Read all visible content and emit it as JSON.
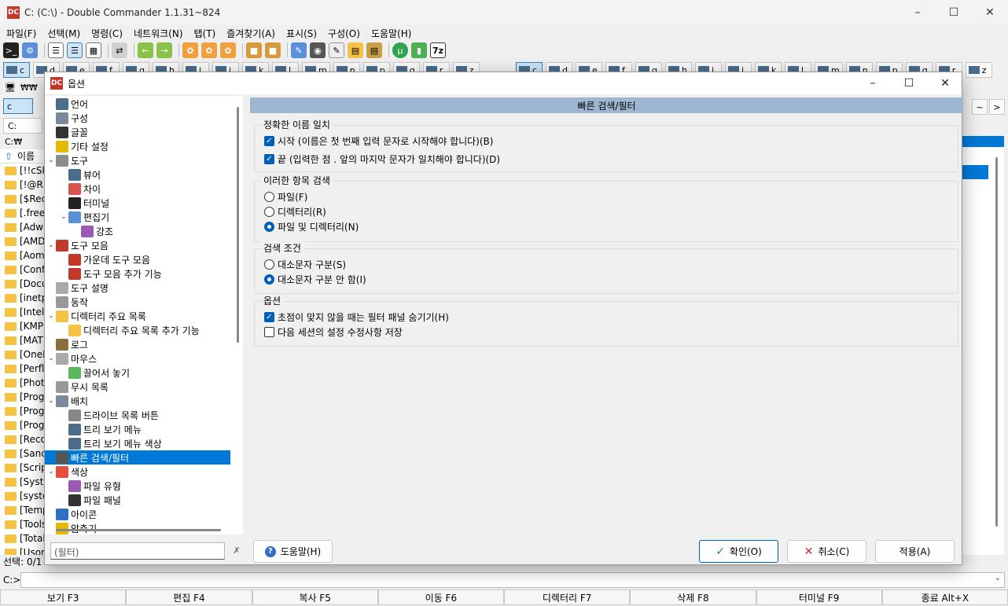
{
  "window": {
    "title": "C: (C:\\) - Double Commander 1.1.31~824",
    "logo": "DC"
  },
  "menu": [
    "파일(F)",
    "선택(M)",
    "명령(C)",
    "네트워크(N)",
    "탭(T)",
    "즐겨찾기(A)",
    "표시(S)",
    "구성(O)",
    "도움말(H)"
  ],
  "toolbar": {
    "last_button": "7z"
  },
  "drives_left": [
    "c",
    "d",
    "e",
    "f",
    "g",
    "h",
    "i",
    "j",
    "k",
    "l",
    "m",
    "n",
    "p",
    "q",
    "r",
    "z"
  ],
  "drives_right": [
    "c",
    "d",
    "e",
    "f",
    "g",
    "h",
    "i",
    "j",
    "k",
    "l",
    "m",
    "n",
    "p",
    "q",
    "r",
    "z"
  ],
  "left_panel": {
    "net_label": "₩₩",
    "tab": "c",
    "path": "C:",
    "current_dir": "C:₩",
    "column_name": "이름",
    "items": [
      "[!!cSk",
      "[!@RI",
      "[$Rec",
      "[.free",
      "[Adw",
      "[AMD",
      "[Aom",
      "[Conf",
      "[Docu",
      "[inetp",
      "[Intel]",
      "[KMP",
      "[MAT",
      "[OneI",
      "[Perfl",
      "[Phot",
      "[Prog",
      "[Prog",
      "[Prog",
      "[Reco",
      "[Sanc",
      "[Scrip",
      "[Syste",
      "[syste",
      "[Temp",
      "[Tools",
      "[Total",
      "[Usor"
    ],
    "status": "선택: 0/1"
  },
  "right_panel": {
    "nav_prev": "~",
    "nav_next": ">"
  },
  "command_line": {
    "label": "C:>",
    "value": ""
  },
  "function_keys": [
    "보기 F3",
    "편집 F4",
    "복사 F5",
    "이동 F6",
    "디렉터리 F7",
    "삭제 F8",
    "터미널 F9",
    "종료 Alt+X"
  ],
  "dialog": {
    "title": "옵션",
    "tree": [
      {
        "label": "언어",
        "indent": 0,
        "expander": "",
        "icon": "language-icon",
        "color": "#4a6d8c",
        "selected": false
      },
      {
        "label": "구성",
        "indent": 0,
        "expander": "",
        "icon": "configuration-icon",
        "color": "#7a8a9a",
        "selected": false
      },
      {
        "label": "글꼴",
        "indent": 0,
        "expander": "",
        "icon": "font-icon",
        "color": "#333333",
        "selected": false
      },
      {
        "label": "기타 설정",
        "indent": 0,
        "expander": "",
        "icon": "misc-settings-icon",
        "color": "#e6b800",
        "selected": false
      },
      {
        "label": "도구",
        "indent": 0,
        "expander": "⌄",
        "icon": "tools-icon",
        "color": "#8c8c8c",
        "selected": false
      },
      {
        "label": "뷰어",
        "indent": 1,
        "expander": "",
        "icon": "viewer-icon",
        "color": "#4a6d8c",
        "selected": false
      },
      {
        "label": "차이",
        "indent": 1,
        "expander": "",
        "icon": "diff-icon",
        "color": "#d9534f",
        "selected": false
      },
      {
        "label": "터미널",
        "indent": 1,
        "expander": "",
        "icon": "terminal-icon",
        "color": "#222222",
        "selected": false
      },
      {
        "label": "편집기",
        "indent": 1,
        "expander": "⌄",
        "icon": "editor-icon",
        "color": "#5b8fd8",
        "selected": false
      },
      {
        "label": "강조",
        "indent": 2,
        "expander": "",
        "icon": "highlight-icon",
        "color": "#9b59b6",
        "selected": false
      },
      {
        "label": "도구 모음",
        "indent": 0,
        "expander": "⌄",
        "icon": "toolbar-icon",
        "color": "#c0392b",
        "selected": false
      },
      {
        "label": "가운데 도구 모음",
        "indent": 1,
        "expander": "",
        "icon": "middle-toolbar-icon",
        "color": "#c0392b",
        "selected": false
      },
      {
        "label": "도구 모음 추가 기능",
        "indent": 1,
        "expander": "",
        "icon": "toolbar-extra-icon",
        "color": "#c0392b",
        "selected": false
      },
      {
        "label": "도구 설명",
        "indent": 0,
        "expander": "",
        "icon": "tooltip-icon",
        "color": "#aaaaaa",
        "selected": false
      },
      {
        "label": "동작",
        "indent": 0,
        "expander": "",
        "icon": "behavior-icon",
        "color": "#999999",
        "selected": false
      },
      {
        "label": "디렉터리 주요 목록",
        "indent": 0,
        "expander": "⌄",
        "icon": "directory-hotlist-icon",
        "color": "#f6c244",
        "selected": false
      },
      {
        "label": "디렉터리 주요 목록 추가 기능",
        "indent": 1,
        "expander": "",
        "icon": "hotlist-extra-icon",
        "color": "#f6c244",
        "selected": false
      },
      {
        "label": "로그",
        "indent": 0,
        "expander": "",
        "icon": "log-icon",
        "color": "#8a6d3b",
        "selected": false
      },
      {
        "label": "마우스",
        "indent": 0,
        "expander": "⌄",
        "icon": "mouse-icon",
        "color": "#aaaaaa",
        "selected": false
      },
      {
        "label": "끌어서 놓기",
        "indent": 1,
        "expander": "",
        "icon": "drag-drop-icon",
        "color": "#5cb85c",
        "selected": false
      },
      {
        "label": "무시 목록",
        "indent": 0,
        "expander": "",
        "icon": "ignore-list-icon",
        "color": "#999999",
        "selected": false
      },
      {
        "label": "배치",
        "indent": 0,
        "expander": "⌄",
        "icon": "layout-icon",
        "color": "#7a8a9a",
        "selected": false
      },
      {
        "label": "드라이브 목록 버튼",
        "indent": 1,
        "expander": "",
        "icon": "drive-list-icon",
        "color": "#888888",
        "selected": false
      },
      {
        "label": "트리 보기 메뉴",
        "indent": 1,
        "expander": "",
        "icon": "tree-menu-icon",
        "color": "#4a6d8c",
        "selected": false
      },
      {
        "label": "트리 보기 메뉴 색상",
        "indent": 1,
        "expander": "",
        "icon": "tree-menu-color-icon",
        "color": "#4a6d8c",
        "selected": false
      },
      {
        "label": "빠른 검색/필터",
        "indent": 0,
        "expander": "",
        "icon": "quick-search-icon",
        "color": "#555555",
        "selected": true
      },
      {
        "label": "색상",
        "indent": 0,
        "expander": "⌄",
        "icon": "colors-icon",
        "color": "#e74c3c",
        "selected": false
      },
      {
        "label": "파일 유형",
        "indent": 1,
        "expander": "",
        "icon": "file-types-icon",
        "color": "#9b59b6",
        "selected": false
      },
      {
        "label": "파일 패널",
        "indent": 1,
        "expander": "",
        "icon": "file-panels-icon",
        "color": "#333333",
        "selected": false
      },
      {
        "label": "아이콘",
        "indent": 0,
        "expander": "",
        "icon": "icons-icon",
        "color": "#2f6fc6",
        "selected": false
      },
      {
        "label": "압축기",
        "indent": 0,
        "expander": "",
        "icon": "archiver-icon",
        "color": "#e6b800",
        "selected": false
      }
    ],
    "page_title": "빠른 검색/필터",
    "groups": {
      "exact": {
        "title": "정확한 이름 일치",
        "start": {
          "label": "시작 (이름은 첫 번째 입력 문자로 시작해야 합니다)(B)",
          "checked": true
        },
        "end": {
          "label": "끝 (입력한 점 . 앞의 마지막 문자가 일치해야 합니다)(D)",
          "checked": true
        }
      },
      "search_items": {
        "title": "이러한 항목 검색",
        "options": [
          "파일(F)",
          "디렉터리(R)",
          "파일 및 디렉터리(N)"
        ],
        "selected": 2
      },
      "criteria": {
        "title": "검색 조건",
        "options": [
          "대소문자 구분(S)",
          "대소문자 구분 안 함(I)"
        ],
        "selected": 1
      },
      "options": {
        "title": "옵션",
        "hide_filter": {
          "label": "초점이 맞지 않을 때는 필터 패널 숨기기(H)",
          "checked": true
        },
        "save_session": {
          "label": "다음 세션의 설정 수정사항 저장",
          "checked": false
        }
      }
    },
    "filter_placeholder": "(필터)",
    "buttons": {
      "help": "도움말(H)",
      "ok": "확인(O)",
      "cancel": "취소(C)",
      "apply": "적용(A)"
    }
  }
}
